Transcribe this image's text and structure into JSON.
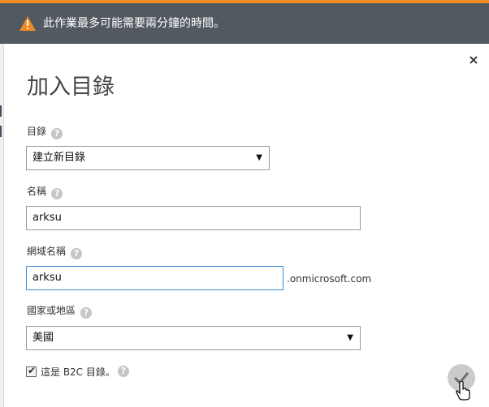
{
  "warning": {
    "text": "此作業最多可能需要兩分鐘的時間。",
    "icon": "warning-icon"
  },
  "dialog": {
    "title": "加入目錄",
    "close_icon": "close-icon",
    "close_glyph": "×"
  },
  "fields": {
    "directory": {
      "label": "目錄",
      "help": "?",
      "selected": "建立新目錄"
    },
    "name": {
      "label": "名稱",
      "help": "?",
      "value": "arksu"
    },
    "domain": {
      "label": "網域名稱",
      "help": "?",
      "value": "arksu",
      "suffix": ".onmicrosoft.com"
    },
    "country": {
      "label": "國家或地區",
      "help": "?",
      "selected": "美國"
    },
    "b2c": {
      "label": "這是 B2C 目錄。",
      "checked": true,
      "help": "?"
    }
  },
  "confirm": {
    "icon": "checkmark-icon"
  },
  "colors": {
    "accent": "#f08a24",
    "warning_bar": "#525961",
    "focus_border": "#3b8ed8",
    "confirm_bg": "#cbcbcb"
  }
}
